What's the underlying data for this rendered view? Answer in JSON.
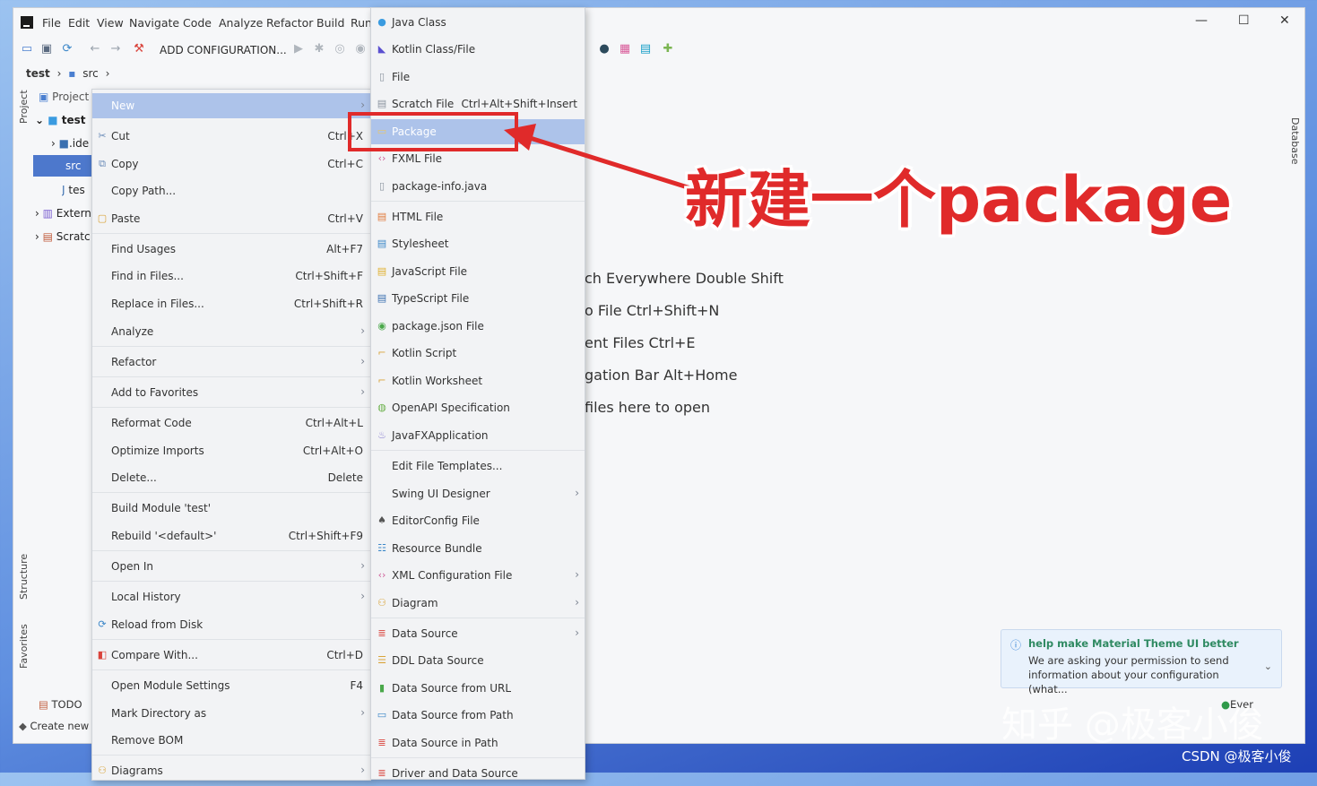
{
  "menubar": {
    "items": [
      "File",
      "Edit",
      "View",
      "Navigate",
      "Code",
      "Analyze",
      "Refactor",
      "Build",
      "Run"
    ]
  },
  "window_controls": [
    "—",
    "☐",
    "✕"
  ],
  "toolbar": {
    "config_label": "ADD CONFIGURATION..."
  },
  "breadcrumb": [
    "test",
    "›",
    "src",
    "›"
  ],
  "project_panel": {
    "title": "Project",
    "nodes": [
      {
        "label": "test",
        "indent": 0
      },
      {
        "label": ".ide",
        "indent": 1
      },
      {
        "label": "src",
        "indent": 1
      },
      {
        "label": "tes",
        "indent": 1
      },
      {
        "label": "Extern",
        "indent": 0
      },
      {
        "label": "Scratc",
        "indent": 0
      }
    ]
  },
  "side_labels": {
    "project": "Project",
    "structure": "Structure",
    "favorites": "Favorites",
    "database": "Database"
  },
  "context_menu": {
    "items": [
      {
        "label": "New",
        "shortcut": "",
        "arrow": true,
        "highlight": true,
        "icon": ""
      },
      {
        "label": "Cut",
        "shortcut": "Ctrl+X",
        "icon": "scissors-icon"
      },
      {
        "label": "Copy",
        "shortcut": "Ctrl+C",
        "icon": "copy-icon"
      },
      {
        "label": "Copy Path...",
        "shortcut": ""
      },
      {
        "label": "Paste",
        "shortcut": "Ctrl+V",
        "icon": "paste-icon"
      },
      {
        "label": "Find Usages",
        "shortcut": "Alt+F7"
      },
      {
        "label": "Find in Files...",
        "shortcut": "Ctrl+Shift+F"
      },
      {
        "label": "Replace in Files...",
        "shortcut": "Ctrl+Shift+R"
      },
      {
        "label": "Analyze",
        "shortcut": "",
        "arrow": true
      },
      {
        "label": "Refactor",
        "shortcut": "",
        "arrow": true
      },
      {
        "label": "Add to Favorites",
        "shortcut": "",
        "arrow": true
      },
      {
        "label": "Reformat Code",
        "shortcut": "Ctrl+Alt+L"
      },
      {
        "label": "Optimize Imports",
        "shortcut": "Ctrl+Alt+O"
      },
      {
        "label": "Delete...",
        "shortcut": "Delete"
      },
      {
        "label": "Build Module 'test'",
        "shortcut": ""
      },
      {
        "label": "Rebuild '<default>'",
        "shortcut": "Ctrl+Shift+F9"
      },
      {
        "label": "Open In",
        "shortcut": "",
        "arrow": true
      },
      {
        "label": "Local History",
        "shortcut": "",
        "arrow": true
      },
      {
        "label": "Reload from Disk",
        "shortcut": "",
        "icon": "reload-icon"
      },
      {
        "label": "Compare With...",
        "shortcut": "Ctrl+D",
        "icon": "compare-icon"
      },
      {
        "label": "Open Module Settings",
        "shortcut": "F4"
      },
      {
        "label": "Mark Directory as",
        "shortcut": "",
        "arrow": true
      },
      {
        "label": "Remove BOM",
        "shortcut": ""
      },
      {
        "label": "Diagrams",
        "shortcut": "",
        "arrow": true,
        "icon": "diagram-icon"
      }
    ]
  },
  "new_submenu": {
    "items": [
      {
        "label": "Java Class",
        "shortcut": "",
        "icon": "java-class-icon"
      },
      {
        "label": "Kotlin Class/File",
        "shortcut": "",
        "icon": "kotlin-icon"
      },
      {
        "label": "File",
        "shortcut": "",
        "icon": "file-icon"
      },
      {
        "label": "Scratch File",
        "shortcut": "Ctrl+Alt+Shift+Insert",
        "icon": "scratch-file-icon"
      },
      {
        "label": "Package",
        "shortcut": "",
        "icon": "package-icon",
        "highlight": true
      },
      {
        "label": "FXML File",
        "shortcut": "",
        "icon": "fxml-icon"
      },
      {
        "label": "package-info.java",
        "shortcut": "",
        "icon": "java-file-icon"
      },
      {
        "label": "HTML File",
        "shortcut": "",
        "icon": "html-icon"
      },
      {
        "label": "Stylesheet",
        "shortcut": "",
        "icon": "css-icon"
      },
      {
        "label": "JavaScript File",
        "shortcut": "",
        "icon": "js-icon"
      },
      {
        "label": "TypeScript File",
        "shortcut": "",
        "icon": "ts-icon"
      },
      {
        "label": "package.json File",
        "shortcut": "",
        "icon": "npm-icon"
      },
      {
        "label": "Kotlin Script",
        "shortcut": "",
        "icon": "kotlin-script-icon"
      },
      {
        "label": "Kotlin Worksheet",
        "shortcut": "",
        "icon": "kotlin-worksheet-icon"
      },
      {
        "label": "OpenAPI Specification",
        "shortcut": "",
        "icon": "openapi-icon"
      },
      {
        "label": "JavaFXApplication",
        "shortcut": "",
        "icon": "javafx-icon"
      },
      {
        "label": "Edit File Templates...",
        "shortcut": ""
      },
      {
        "label": "Swing UI Designer",
        "shortcut": "",
        "arrow": true
      },
      {
        "label": "EditorConfig File",
        "shortcut": "",
        "icon": "editorconfig-icon"
      },
      {
        "label": "Resource Bundle",
        "shortcut": "",
        "icon": "resource-bundle-icon"
      },
      {
        "label": "XML Configuration File",
        "shortcut": "",
        "arrow": true,
        "icon": "xml-icon"
      },
      {
        "label": "Diagram",
        "shortcut": "",
        "arrow": true,
        "icon": "diagram-icon"
      },
      {
        "label": "Data Source",
        "shortcut": "",
        "arrow": true,
        "icon": "database-icon"
      },
      {
        "label": "DDL Data Source",
        "shortcut": "",
        "icon": "ddl-icon"
      },
      {
        "label": "Data Source from URL",
        "shortcut": "",
        "icon": "url-icon"
      },
      {
        "label": "Data Source from Path",
        "shortcut": "",
        "icon": "folder-icon"
      },
      {
        "label": "Data Source in Path",
        "shortcut": "",
        "icon": "database-icon"
      },
      {
        "label": "Driver and Data Source",
        "shortcut": "",
        "icon": "driver-icon"
      }
    ]
  },
  "editor_hints": [
    "ch Everywhere Double Shift",
    "o File Ctrl+Shift+N",
    "ent Files Ctrl+E",
    "gation Bar Alt+Home",
    "files here to open"
  ],
  "notification": {
    "title": "help make Material Theme UI better",
    "body": "We are asking your permission to send information about your configuration (what..."
  },
  "bottom_bar": {
    "todo": "TODO",
    "create_new": "Create new",
    "ever": "Ever"
  },
  "annotation_text": "新建一个package",
  "watermarks": {
    "zhihu": "知乎 @极客小俊",
    "csdn": "CSDN @极客小俊"
  },
  "colors": {
    "highlight": "#adc3ea",
    "selected": "#4d78cc",
    "annotation": "#e02a2a"
  }
}
